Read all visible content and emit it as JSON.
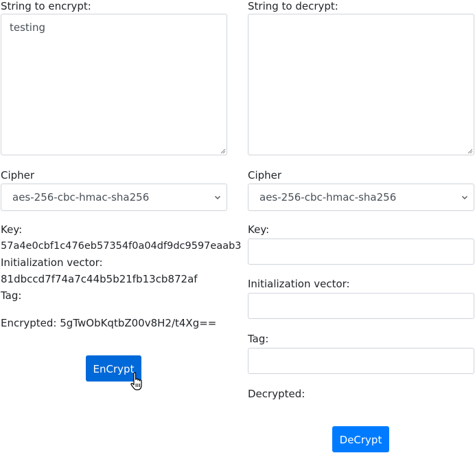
{
  "encrypt": {
    "label": "String to encrypt:",
    "text": "testing",
    "cipher_label": "Cipher",
    "cipher_value": "aes-256-cbc-hmac-sha256",
    "key_label": "Key:",
    "key_value": "57a4e0cbf1c476eb57354f0a04df9dc9597eaab3",
    "iv_label": "Initialization vector:",
    "iv_value": "81dbccd7f74a7c44b5b21fb13cb872af",
    "tag_label": "Tag:",
    "encrypted_text": "Encrypted: 5gTwObKqtbZ00v8H2/t4Xg==",
    "button_label": "EnCrypt"
  },
  "decrypt": {
    "label": "String to decrypt:",
    "text": "",
    "cipher_label": "Cipher",
    "cipher_value": "aes-256-cbc-hmac-sha256",
    "key_label": "Key:",
    "iv_label": "Initialization vector:",
    "tag_label": "Tag:",
    "decrypted_label": "Decrypted:",
    "button_label": "DeCrypt"
  },
  "icons": {
    "select_arrow": "chevron-down-icon",
    "resize": "resize-grip-icon",
    "cursor": "hand-pointer-icon"
  },
  "colors": {
    "primary": "#007bff",
    "primary_hover": "#0069d9",
    "border": "#ced4da",
    "text": "#212529"
  }
}
